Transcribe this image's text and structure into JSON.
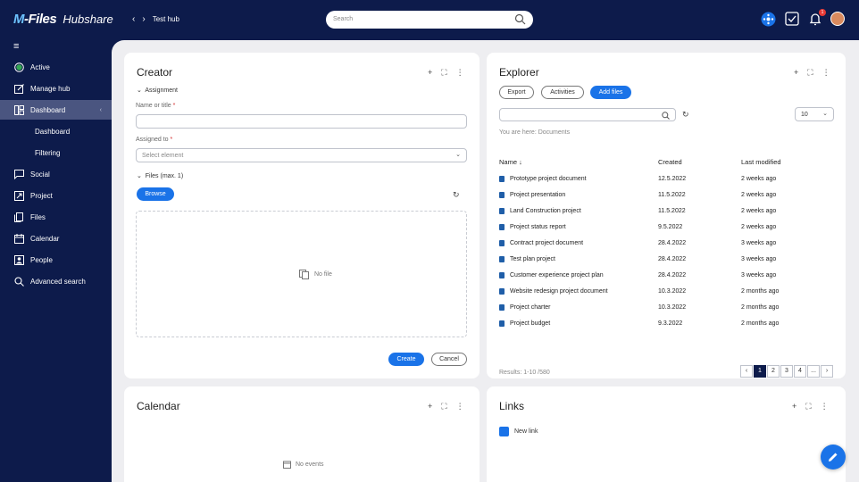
{
  "header": {
    "logo_brand": "M-Files",
    "logo_sub": "Hubshare",
    "breadcrumb": "Test hub",
    "search_placeholder": "Search",
    "notification_count": "1"
  },
  "sidebar": {
    "items": [
      {
        "label": "Active",
        "icon": "active-status-icon"
      },
      {
        "label": "Manage hub",
        "icon": "edit-icon"
      },
      {
        "label": "Dashboard",
        "icon": "dashboard-icon"
      },
      {
        "label": "Dashboard"
      },
      {
        "label": "Filtering"
      },
      {
        "label": "Social",
        "icon": "chat-icon"
      },
      {
        "label": "Project",
        "icon": "project-icon"
      },
      {
        "label": "Files",
        "icon": "files-icon"
      },
      {
        "label": "Calendar",
        "icon": "calendar-icon"
      },
      {
        "label": "People",
        "icon": "people-icon"
      },
      {
        "label": "Advanced search",
        "icon": "search-icon"
      }
    ]
  },
  "creator": {
    "title": "Creator",
    "assignment_label": "Assignment",
    "name_label": "Name or title",
    "assigned_label": "Assigned to",
    "assigned_placeholder": "Select element",
    "files_label": "Files (max. 1)",
    "browse_label": "Browse",
    "no_file": "No file",
    "create_label": "Create",
    "cancel_label": "Cancel"
  },
  "explorer": {
    "title": "Explorer",
    "buttons": [
      "Export",
      "Activities",
      "Add files"
    ],
    "page_size": "10",
    "location": "You are here: Documents",
    "columns": [
      "Name",
      "Created",
      "Last modified"
    ],
    "rows": [
      {
        "name": "Prototype project document",
        "created": "12.5.2022",
        "modified": "2 weeks ago"
      },
      {
        "name": "Project presentation",
        "created": "11.5.2022",
        "modified": "2 weeks ago"
      },
      {
        "name": "Land Construction project",
        "created": "11.5.2022",
        "modified": "2 weeks ago"
      },
      {
        "name": "Project status report",
        "created": "9.5.2022",
        "modified": "2 weeks ago"
      },
      {
        "name": "Contract project document",
        "created": "28.4.2022",
        "modified": "3 weeks ago"
      },
      {
        "name": "Test plan project",
        "created": "28.4.2022",
        "modified": "3 weeks ago"
      },
      {
        "name": "Customer experience project plan",
        "created": "28.4.2022",
        "modified": "3 weeks ago"
      },
      {
        "name": "Website redesign project document",
        "created": "10.3.2022",
        "modified": "2 months ago"
      },
      {
        "name": "Project charter",
        "created": "10.3.2022",
        "modified": "2 months ago"
      },
      {
        "name": "Project budget",
        "created": "9.3.2022",
        "modified": "2 months ago"
      }
    ],
    "results": "Results: 1-10 /580",
    "pages": [
      "‹",
      "1",
      "2",
      "3",
      "4",
      "...",
      "›"
    ]
  },
  "calendar": {
    "title": "Calendar",
    "empty": "No events"
  },
  "links": {
    "title": "Links",
    "items": [
      "New link"
    ]
  },
  "colors": {
    "navy": "#0d1b4b",
    "accent": "#1a73e8",
    "active_green": "#34a853"
  }
}
